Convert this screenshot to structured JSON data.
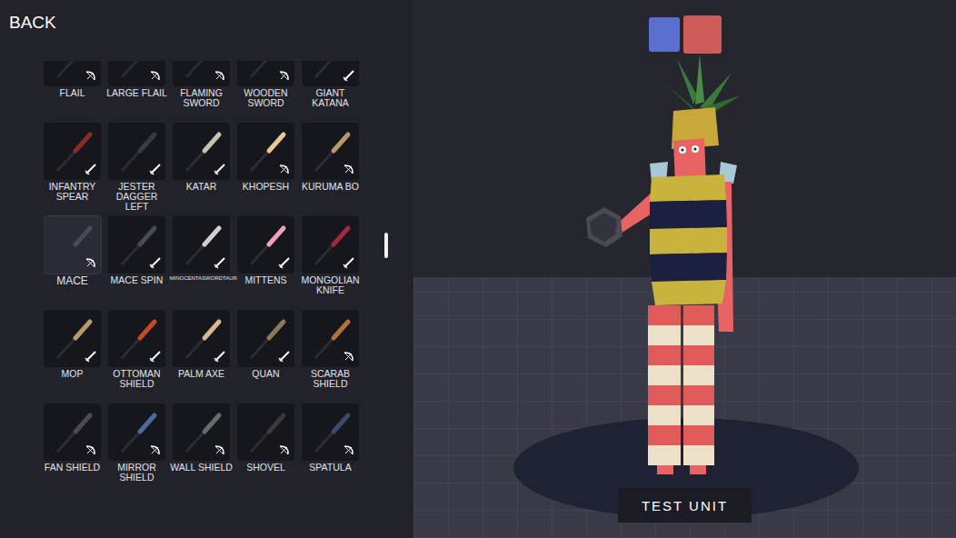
{
  "back": "BACK",
  "weapons": [
    {
      "label": "FLAIL",
      "kind": "bow",
      "color": "#44444c",
      "selected": false
    },
    {
      "label": "LARGE FLAIL",
      "kind": "bow",
      "color": "#b03434",
      "selected": false
    },
    {
      "label": "FLAMING SWORD",
      "kind": "bow",
      "color": "#55555c",
      "selected": false
    },
    {
      "label": "WOODEN SWORD",
      "kind": "bow",
      "color": "#a0704a",
      "selected": false
    },
    {
      "label": "GIANT KATANA",
      "kind": "sword",
      "color": "#9a3a3a",
      "selected": false
    },
    {
      "label": "INFANTRY SPEAR",
      "kind": "sword",
      "color": "#8a2a2a",
      "selected": false
    },
    {
      "label": "JESTER DAGGER LEFT",
      "kind": "sword",
      "color": "#3a3a40",
      "selected": false
    },
    {
      "label": "KATAR",
      "kind": "sword",
      "color": "#c8c2b0",
      "selected": false
    },
    {
      "label": "KHOPESH",
      "kind": "bow",
      "color": "#e8c89a",
      "selected": false
    },
    {
      "label": "KURUMA BO",
      "kind": "bow",
      "color": "#b89a6a",
      "selected": false
    },
    {
      "label": "MACE",
      "kind": "bow",
      "color": "#4a4a54",
      "selected": true
    },
    {
      "label": "MACE SPIN",
      "kind": "sword",
      "color": "#4a4a54",
      "selected": false
    },
    {
      "label": "MINOCENTASWORDTAUR",
      "kind": "sword",
      "color": "#d0d0d0",
      "selected": false
    },
    {
      "label": "MITTENS",
      "kind": "sword",
      "color": "#f0a0c0",
      "selected": false
    },
    {
      "label": "MONGOLIAN KNIFE",
      "kind": "sword",
      "color": "#a02a3a",
      "selected": false
    },
    {
      "label": "MOP",
      "kind": "sword",
      "color": "#b89a6a",
      "selected": false
    },
    {
      "label": "OTTOMAN SHIELD",
      "kind": "sword",
      "color": "#c04a2a",
      "selected": false
    },
    {
      "label": "PALM AXE",
      "kind": "sword",
      "color": "#d8b890",
      "selected": false
    },
    {
      "label": "QUAN",
      "kind": "sword",
      "color": "#8a7a5a",
      "selected": false
    },
    {
      "label": "SCARAB SHIELD",
      "kind": "bow",
      "color": "#b07040",
      "selected": false
    },
    {
      "label": "FAN SHIELD",
      "kind": "bow",
      "color": "#4a4a54",
      "selected": false
    },
    {
      "label": "MIRROR SHIELD",
      "kind": "bow",
      "color": "#4a6aa0",
      "selected": false
    },
    {
      "label": "WALL SHIELD",
      "kind": "bow",
      "color": "#6a6a6a",
      "selected": false
    },
    {
      "label": "SHOVEL",
      "kind": "bow",
      "color": "#3a3a3a",
      "selected": false
    },
    {
      "label": "SPATULA",
      "kind": "bow",
      "color": "#3a4a6a",
      "selected": false
    }
  ],
  "scrollbar": {
    "level": 0.38
  },
  "swatches": [
    {
      "color": "#5a6fd0",
      "selected": false
    },
    {
      "color": "#cf5a5a",
      "selected": true
    }
  ],
  "test_button": "TEST UNIT"
}
